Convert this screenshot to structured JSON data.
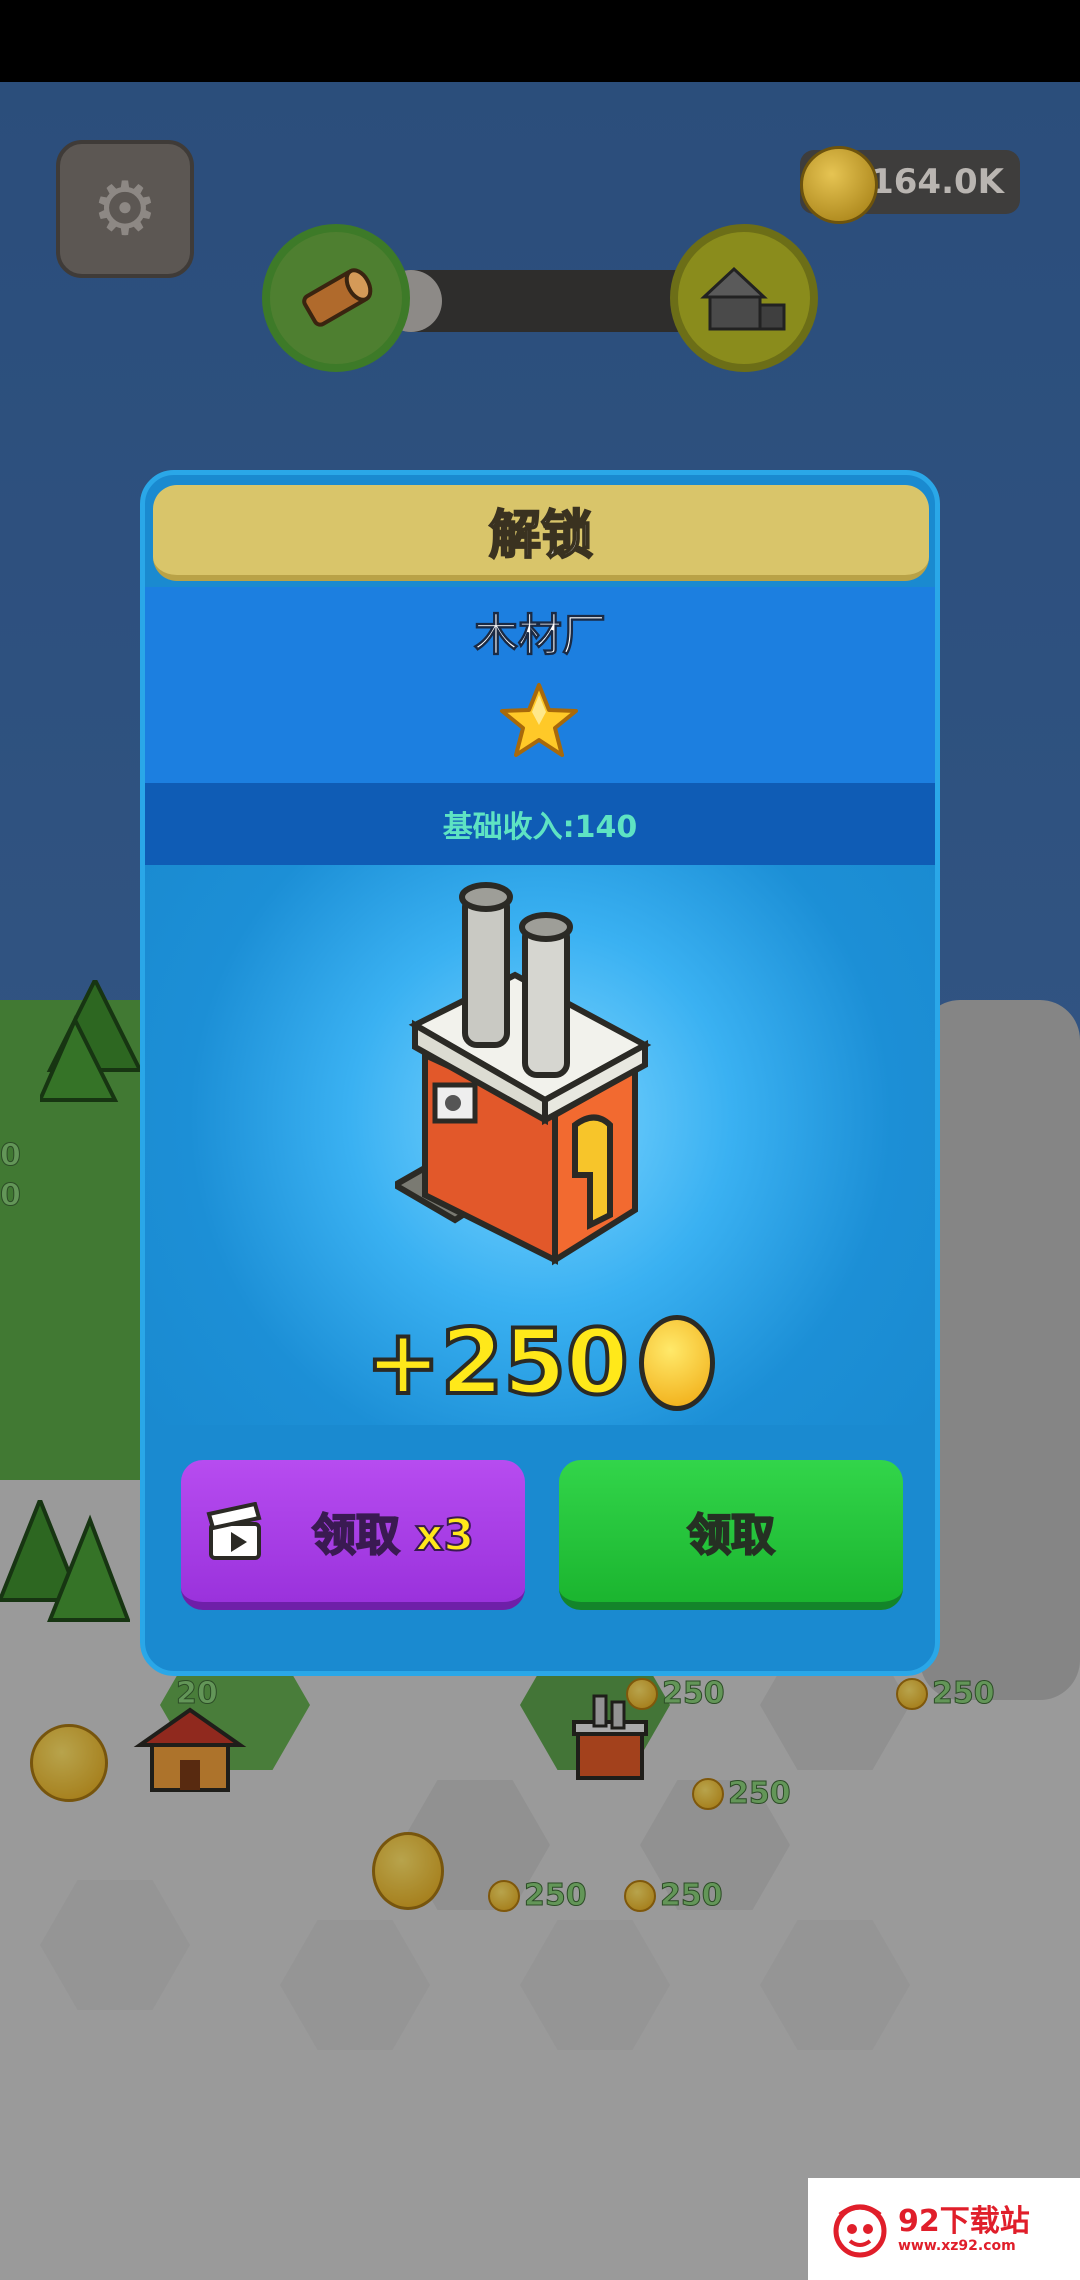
{
  "hud": {
    "coin_count": "164.0K",
    "settings_icon": "gear-icon",
    "level_progress": 0.1,
    "progress_start_icon": "wood-log-icon",
    "progress_end_icon": "house-icon"
  },
  "map": {
    "labels": [
      "0",
      "0",
      "20",
      "250",
      "250",
      "250",
      "250",
      "250"
    ]
  },
  "dialog": {
    "title": "解锁",
    "building_name": "木材厂",
    "stars": 1,
    "base_income": "基础收入:140",
    "reward": "+250",
    "double_button": {
      "label": "领取 x3",
      "icon": "video-clapper-icon"
    },
    "claim_button": {
      "label": "领取"
    }
  },
  "watermark": {
    "title": "92下载站",
    "url": "www.xz92.com"
  },
  "colors": {
    "dialog_bg": "#1a8ad0",
    "title_bar": "#d9c56a",
    "reward_text": "#ffe81a",
    "purple_button": "#a93ee6",
    "green_button": "#26c53c",
    "income_text": "#5ee3c3"
  }
}
